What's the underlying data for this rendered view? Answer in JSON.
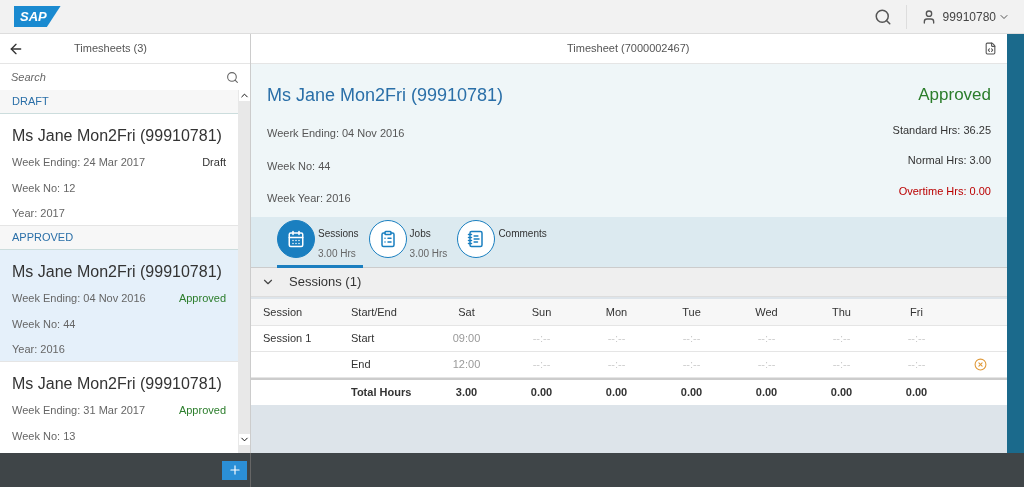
{
  "shell": {
    "logo": "SAP",
    "user": "99910780"
  },
  "master": {
    "title": "Timesheets (3)",
    "search_placeholder": "Search",
    "groups": [
      {
        "title": "DRAFT",
        "items": [
          {
            "name": "Ms Jane Mon2Fri (99910781)",
            "week_ending": "Week Ending: 24 Mar 2017",
            "status": "Draft",
            "kind": "draft",
            "week_no": "Week No: 12",
            "year": "Year: 2017",
            "selected": false
          }
        ]
      },
      {
        "title": "APPROVED",
        "items": [
          {
            "name": "Ms Jane Mon2Fri (99910781)",
            "week_ending": "Week Ending: 04 Nov 2016",
            "status": "Approved",
            "kind": "approved",
            "week_no": "Week No: 44",
            "year": "Year: 2016",
            "selected": true
          },
          {
            "name": "Ms Jane Mon2Fri (99910781)",
            "week_ending": "Week Ending: 31 Mar 2017",
            "status": "Approved",
            "kind": "approved",
            "week_no": "Week No: 13",
            "selected": false
          }
        ]
      }
    ]
  },
  "detail": {
    "title": "Timesheet (7000002467)",
    "header": {
      "name": "Ms Jane Mon2Fri (99910781)",
      "status": "Approved",
      "attributes": [
        "Weerk Ending: 04 Nov 2016",
        "Week No: 44",
        "Week Year: 2016"
      ],
      "stats": [
        {
          "text": "Standard Hrs: 36.25",
          "kind": "none"
        },
        {
          "text": "Normal Hrs: 3.00",
          "kind": "none"
        },
        {
          "text": "Overtime Hrs: 0.00",
          "kind": "error"
        }
      ]
    },
    "tabs": [
      {
        "label": "Sessions",
        "count": "3.00 Hrs",
        "selected": true
      },
      {
        "label": "Jobs",
        "count": "3.00 Hrs",
        "selected": false
      },
      {
        "label": "Comments",
        "selected": false
      }
    ],
    "section": {
      "title": "Sessions (1)",
      "expanded": true
    },
    "table": {
      "columns": [
        "Session",
        "Start/End",
        "Sat",
        "Sun",
        "Mon",
        "Tue",
        "Wed",
        "Thu",
        "Fri"
      ],
      "rows": [
        {
          "session": "Session 1",
          "label": "Start",
          "values": [
            "09:00",
            "--:--",
            "--:--",
            "--:--",
            "--:--",
            "--:--",
            "--:--"
          ],
          "deletable": false
        },
        {
          "label": "End",
          "values": [
            "12:00",
            "--:--",
            "--:--",
            "--:--",
            "--:--",
            "--:--",
            "--:--"
          ],
          "deletable": true
        }
      ],
      "totals": {
        "label": "Total Hours",
        "values": [
          "3.00",
          "0.00",
          "0.00",
          "0.00",
          "0.00",
          "0.00",
          "0.00"
        ]
      }
    }
  }
}
